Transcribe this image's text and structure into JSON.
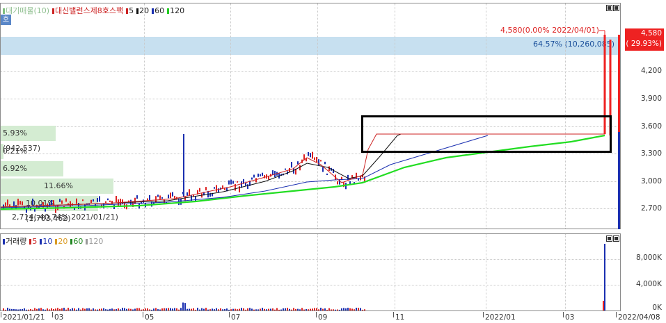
{
  "price_panel": {
    "badge": "호",
    "legend": [
      {
        "label": "대기매물(10)",
        "color": "#7fbf7f"
      },
      {
        "label": "대신밸런스제8호스팩",
        "color": "#cc2222"
      },
      {
        "label": "5",
        "color": "#cc2222"
      },
      {
        "label": "20",
        "color": "#111111"
      },
      {
        "label": "60",
        "color": "#1a2fb0"
      },
      {
        "label": "120",
        "color": "#22cc22"
      }
    ],
    "y_ticks": [
      "4,200",
      "3,900",
      "3,600",
      "3,300",
      "3,000",
      "2,700"
    ],
    "price_tag": {
      "value": "4,580",
      "change": "( 29.93%)"
    },
    "max_annotation": "4,580(0.00% 2022/04/01)",
    "band_label": "64.57% (10,260,085)",
    "volume_profile": [
      {
        "label": "5.93% (942,537)",
        "fill": 0.22
      },
      {
        "label": "0.21% (32,956)",
        "fill": 0.01
      },
      {
        "label": "6.92% (1,099,067)",
        "fill": 0.25
      },
      {
        "label": "11.66% (1,853,128)",
        "fill": 0.45
      },
      {
        "label": "10.01% (1,703,462)",
        "fill": 0.39
      }
    ],
    "min_annotation": "2,714(-40.74% 2021/01/21)"
  },
  "volume_panel": {
    "legend": [
      {
        "label": "거래량",
        "color": "#1a2fb0"
      },
      {
        "label": "5",
        "color": "#cc2222"
      },
      {
        "label": "10",
        "color": "#1a2fb0"
      },
      {
        "label": "20",
        "color": "#d99a22"
      },
      {
        "label": "60",
        "color": "#228822"
      },
      {
        "label": "120",
        "color": "#999999"
      }
    ],
    "y_ticks": [
      "8,000K",
      "4,000K",
      "0K"
    ]
  },
  "x_axis": {
    "ticks": [
      "2021/01/21",
      "03",
      "05",
      "07",
      "09",
      "11",
      "2022/01",
      "03",
      "2022/04/08"
    ]
  }
}
